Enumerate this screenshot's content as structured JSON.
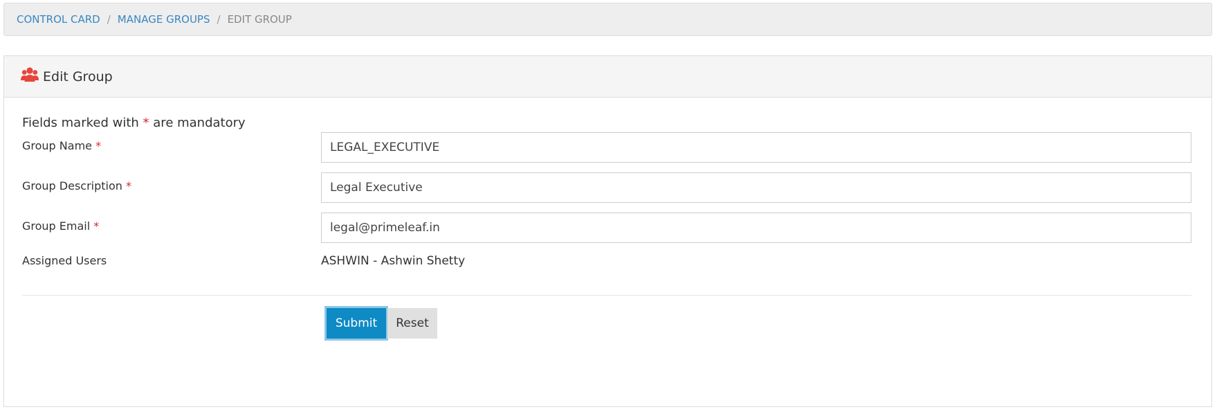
{
  "breadcrumb": {
    "items": [
      "CONTROL CARD",
      "MANAGE GROUPS"
    ],
    "separator": "/",
    "current": "EDIT GROUP"
  },
  "panel": {
    "title": "Edit Group",
    "icon": "users-icon",
    "icon_color": "#e8453c"
  },
  "form": {
    "mandatory_note_prefix": "Fields marked with",
    "mandatory_star": "*",
    "mandatory_note_suffix": "are mandatory",
    "fields": [
      {
        "label": "Group Name",
        "required": "*",
        "value": "LEGAL_EXECUTIVE"
      },
      {
        "label": "Group Description",
        "required": "*",
        "value": "Legal Executive"
      },
      {
        "label": "Group Email",
        "required": "*",
        "value": "legal@primeleaf.in"
      }
    ],
    "assigned_users_label": "Assigned Users",
    "assigned_users_value": "ASHWIN - Ashwin Shetty",
    "submit_label": "Submit",
    "reset_label": "Reset"
  },
  "colors": {
    "link": "#3a87c0",
    "required": "#d9262c",
    "primary_button": "#0e8ac5",
    "secondary_button": "#e0e0e0"
  }
}
